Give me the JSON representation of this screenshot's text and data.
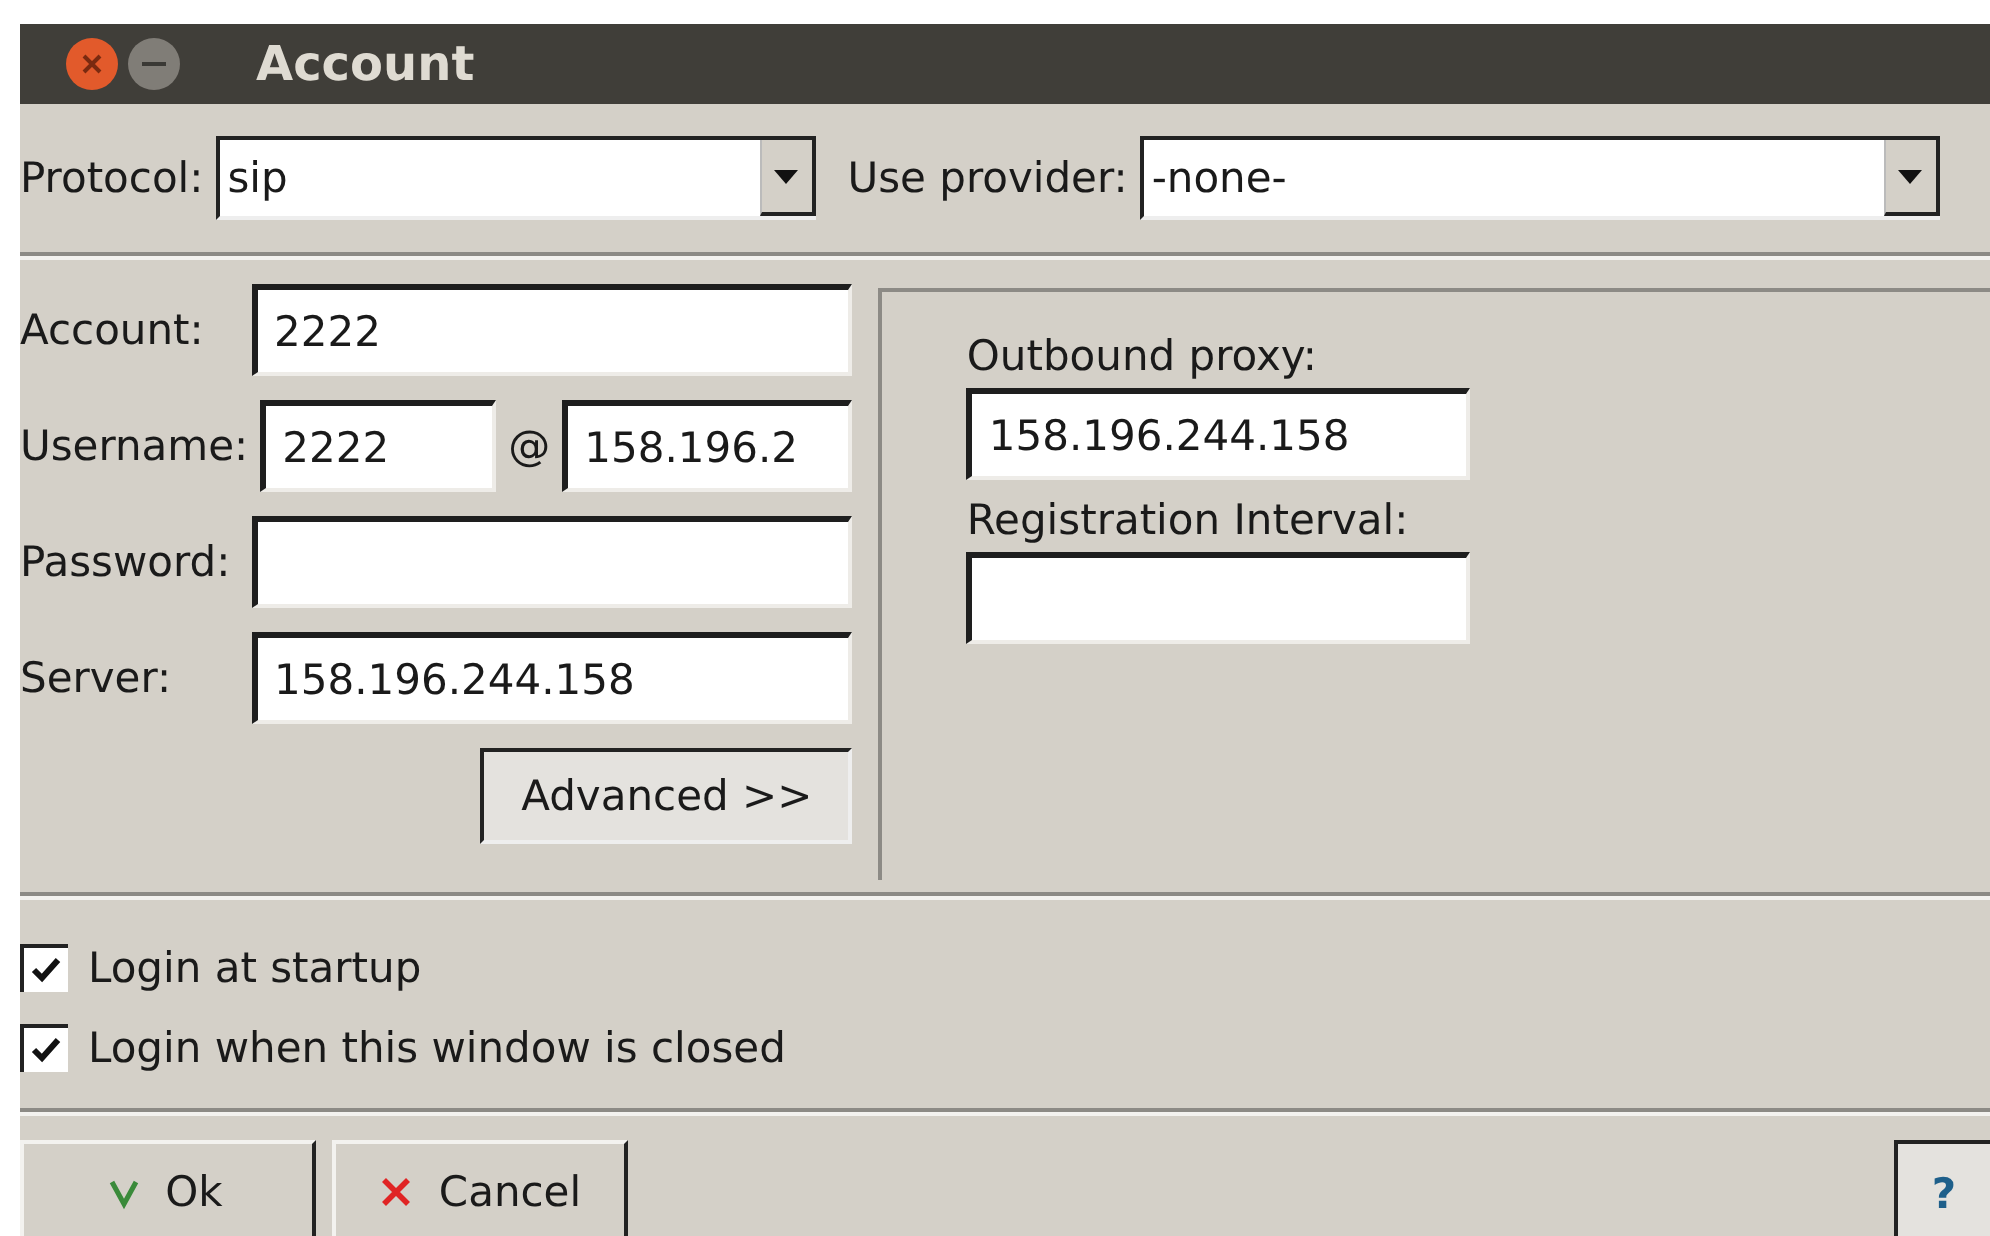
{
  "window": {
    "title": "Account"
  },
  "protocol": {
    "label": "Protocol:",
    "value": "sip"
  },
  "provider": {
    "label": "Use provider:",
    "value": "-none-"
  },
  "account_fields": [
    {
      "kind": "text",
      "label": "Account:",
      "value": "2222"
    },
    {
      "kind": "user_at_domain",
      "label": "Username:",
      "value": "2222",
      "separator": "@",
      "domain": "158.196.2"
    },
    {
      "kind": "text",
      "label": "Password:"
    },
    {
      "kind": "text",
      "label": "Server:",
      "value": "158.196.244.158"
    }
  ],
  "advanced_button": "Advanced >>",
  "advanced": [
    {
      "label": "Outbound proxy:",
      "value": "158.196.244.158"
    },
    {
      "label": "Registration Interval:"
    }
  ],
  "options": [
    {
      "label": "Login at startup",
      "checked": true
    },
    {
      "label": "Login when this window is closed",
      "checked": true
    }
  ],
  "buttons": [
    {
      "kind": "ok",
      "label": "Ok"
    },
    {
      "kind": "cancel",
      "label": "Cancel"
    },
    {
      "kind": "help",
      "label": "?"
    }
  ]
}
